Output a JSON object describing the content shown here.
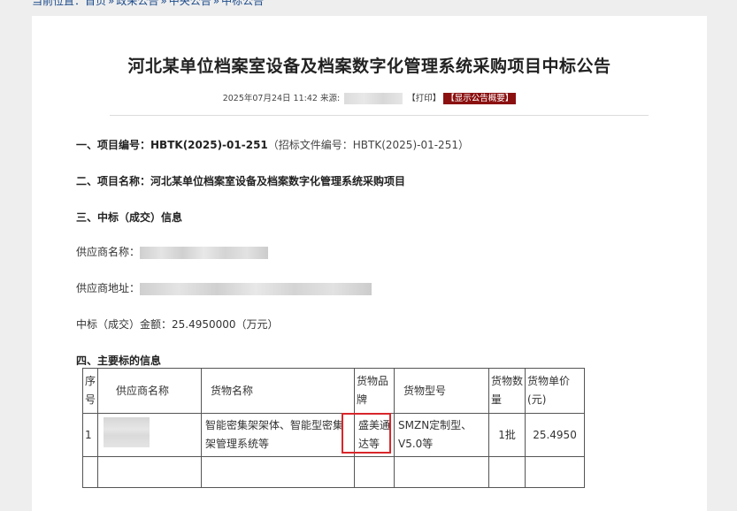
{
  "breadcrumb": {
    "prefix": "当前位置：",
    "items": [
      "首页",
      "政采公告",
      "中央公告",
      "中标公告"
    ],
    "separator": "»"
  },
  "title": "河北某单位档案室设备及档案数字化管理系统采购项目中标公告",
  "meta": {
    "datetime": "2025年07月24日 11:42",
    "source_label": "来源:",
    "print_label": "【打印】",
    "summary_label": "【显示公告概要】"
  },
  "sections": {
    "s1_label": "一、项目编号：",
    "s1_value": "HBTK(2025)-01-251",
    "s1_note": "（招标文件编号：HBTK(2025)-01-251）",
    "s2_label": "二、项目名称：",
    "s2_value": "河北某单位档案室设备及档案数字化管理系统采购项目",
    "s3_label": "三、中标（成交）信息",
    "supplier_name_label": "供应商名称：",
    "supplier_address_label": "供应商地址：",
    "amount_label": "中标（成交）金额：",
    "amount_value": "25.4950000（万元）",
    "s4_label": "四、主要标的信息"
  },
  "table": {
    "headers": [
      "序号",
      "供应商名称",
      "货物名称",
      "货物品牌",
      "货物型号",
      "货物数量",
      "货物单价(元)"
    ],
    "rows": [
      {
        "index": "1",
        "goods_name": "智能密集架架体、智能型密集架管理系统等",
        "brand": "盛美通达等",
        "model": "SMZN定制型、V5.0等",
        "quantity": "1批",
        "price": "25.4950"
      }
    ]
  },
  "colors": {
    "breadcrumb_link": "#1a4a8a",
    "summary_badge": "#8b1010",
    "highlight_box": "#d8262a"
  }
}
